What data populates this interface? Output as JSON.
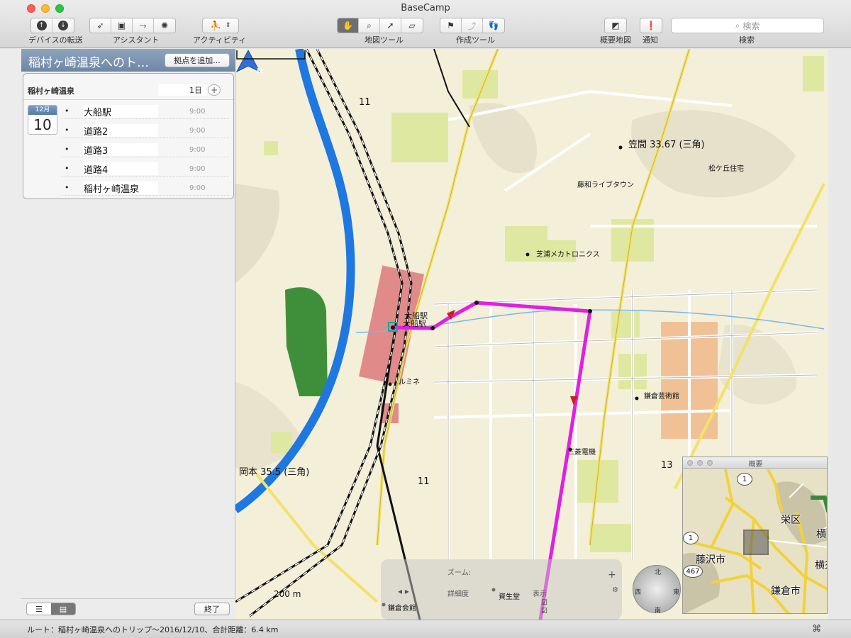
{
  "window": {
    "title": "BaseCamp"
  },
  "toolbar": {
    "device_transfer_label": "デバイスの転送",
    "assistant_label": "アシスタント",
    "activity_label": "アクティビティ",
    "map_tools_label": "地図ツール",
    "create_tools_label": "作成ツール",
    "overview_map_label": "概要地図",
    "notifications_label": "通知",
    "search_label": "検索",
    "search_placeholder": "検索"
  },
  "sidebar": {
    "trip_title": "稲村ヶ崎温泉へのト…",
    "add_waypoint_label": "拠点を追加...",
    "day": {
      "name": "稲村ヶ崎温泉",
      "count": "1日",
      "calendar_month": "12月",
      "calendar_day": "10"
    },
    "waypoints": [
      {
        "name": "大船駅",
        "time": "9:00"
      },
      {
        "name": "道路2",
        "time": "9:00"
      },
      {
        "name": "道路3",
        "time": "9:00"
      },
      {
        "name": "道路4",
        "time": "9:00"
      },
      {
        "name": "稲村ヶ崎温泉",
        "time": "9:00"
      }
    ],
    "finish_label": "終了"
  },
  "map": {
    "compass_label": "N",
    "scale_label": "200 m",
    "labels": {
      "kasama": "笠間 33.67 (三角)",
      "matsugaoka": "松ケ丘住宅",
      "fujiwa": "藤和ライブタウン",
      "shibaura": "芝浦メカトロニクス",
      "ofuna1": "大船駅",
      "ofuna2": "大船駅",
      "lumine": "ルミネ",
      "kamakura_art": "鎌倉芸術館",
      "mitsubishi": "三菱電機",
      "okamoto": "岡本 35.5 (三角)",
      "route11a": "11",
      "route11b": "11",
      "route13": "13",
      "shiseido": "資生堂",
      "kamakura_hall": "鎌倉会館"
    },
    "zoom_overlay": {
      "zoom_label": "ズーム:",
      "detail_label": "詳細度",
      "display_label": "表示"
    },
    "rose": {
      "north": "北",
      "west": "西",
      "east": "東",
      "south": "南"
    }
  },
  "overview": {
    "title": "概要",
    "labels": {
      "fujisawa": "藤沢市",
      "kamakura": "鎌倉市",
      "sakae": "栄区",
      "yoko": "横",
      "yokosu": "横須"
    },
    "badges": {
      "r1a": "1",
      "r1b": "1",
      "r467": "467"
    }
  },
  "status": {
    "text": "ルート：稲村ヶ崎温泉へのトリップ〜2016/12/10、合計距離：6.4 km"
  },
  "colors": {
    "route": "#e020e0",
    "river": "#1e78e0",
    "vegetation": "#3f8f3a",
    "building": "#dfe8a0"
  }
}
